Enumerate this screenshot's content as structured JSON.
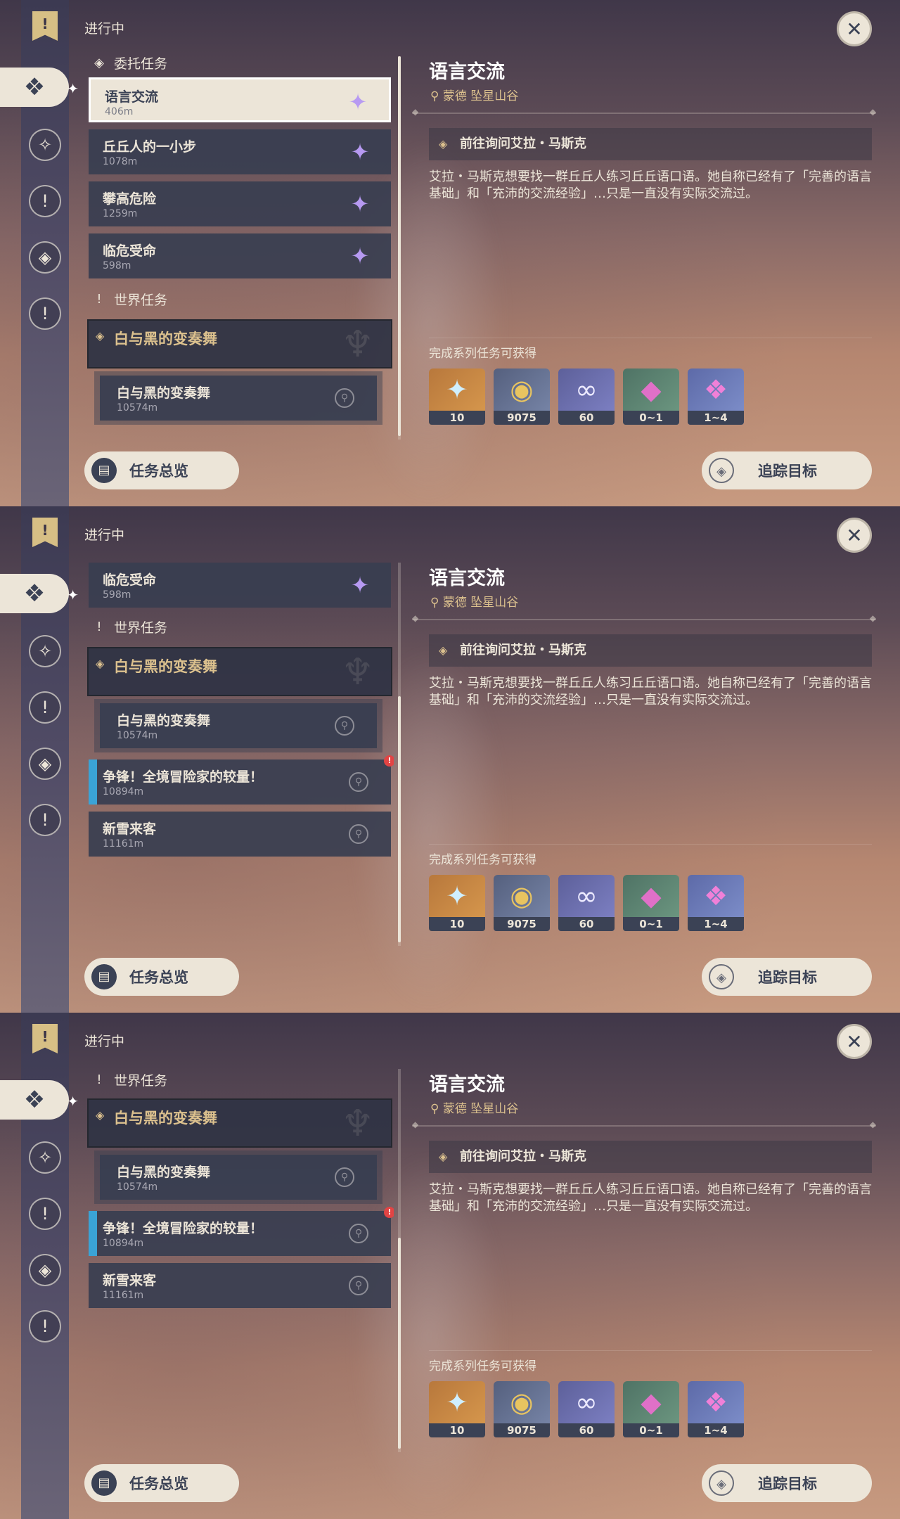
{
  "header": {
    "progress_label": "进行中",
    "close_icon": "close-icon"
  },
  "nav": {
    "items": [
      {
        "icon": "bookmark-icon",
        "glyph": "!"
      },
      {
        "icon": "commission-icon",
        "glyph": "❖"
      },
      {
        "icon": "archon-quest-icon",
        "glyph": "✧"
      },
      {
        "icon": "story-quest-icon",
        "glyph": "!"
      },
      {
        "icon": "commission-diamond-icon",
        "glyph": "◈"
      },
      {
        "icon": "world-quest-icon",
        "glyph": "!"
      }
    ]
  },
  "sections": {
    "commission": "委托任务",
    "world": "世界任务"
  },
  "quests": {
    "commission": [
      {
        "name": "语言交流",
        "distance": "406m"
      },
      {
        "name": "丘丘人的一小步",
        "distance": "1078m"
      },
      {
        "name": "攀高危险",
        "distance": "1259m"
      },
      {
        "name": "临危受命",
        "distance": "598m"
      }
    ],
    "world_group": {
      "name": "白与黑的变奏舞"
    },
    "world_sub": {
      "name": "白与黑的变奏舞",
      "distance": "10574m"
    },
    "world_extra": [
      {
        "name": "争锋！全境冒险家的较量！",
        "distance": "10894m"
      },
      {
        "name": "新雪来客",
        "distance": "11161m"
      }
    ]
  },
  "detail": {
    "title": "语言交流",
    "location": "蒙德 坠星山谷",
    "objective": "前往询问艾拉・马斯克",
    "description": "艾拉・马斯克想要找一群丘丘人练习丘丘语口语。她自称已经有了「完善的语言基础」和「充沛的交流经验」…只是一直没有实际交流过。",
    "rewards_label": "完成系列任务可获得",
    "rewards": [
      {
        "icon": "primogem-icon",
        "glyph": "✦",
        "count": "10"
      },
      {
        "icon": "mora-icon",
        "glyph": "◉",
        "count": "9075"
      },
      {
        "icon": "adventure-exp-icon",
        "glyph": "∞",
        "count": "60"
      },
      {
        "icon": "crystal-chunk-icon",
        "glyph": "◆",
        "count": "0~1"
      },
      {
        "icon": "crystal-cluster-icon",
        "glyph": "❖",
        "count": "1~4"
      }
    ]
  },
  "buttons": {
    "overview": "任务总览",
    "track": "追踪目标"
  },
  "colors": {
    "accent_gold": "#dcc18e",
    "item_bg": "#383e50",
    "cream": "#ece5d8",
    "alert_red": "#e24444",
    "tracked_blue": "#3aa3d6"
  }
}
